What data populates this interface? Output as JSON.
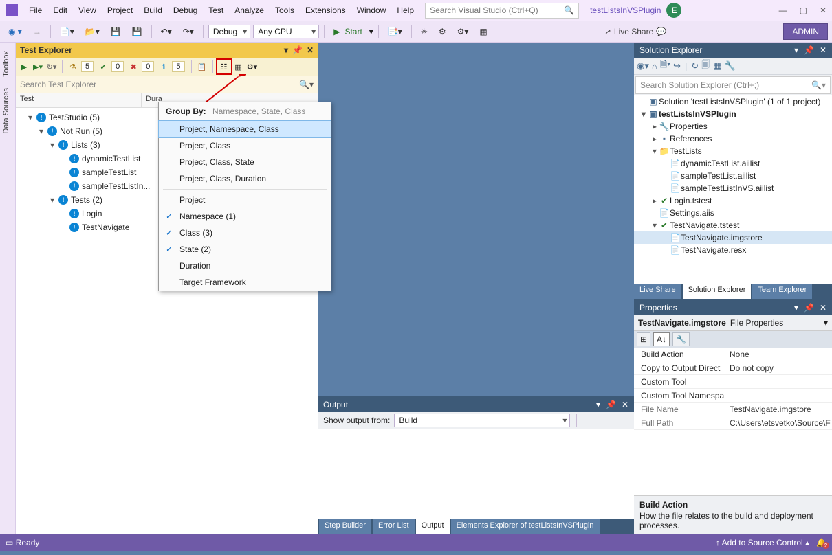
{
  "menu": [
    "File",
    "Edit",
    "View",
    "Project",
    "Build",
    "Debug",
    "Test",
    "Analyze",
    "Tools",
    "Extensions",
    "Window",
    "Help"
  ],
  "search_vs_placeholder": "Search Visual Studio (Ctrl+Q)",
  "project_name": "testListsInVSPlugin",
  "user_initial": "E",
  "toolbar": {
    "config": "Debug",
    "platform": "Any CPU",
    "start": "Start",
    "live_share": "Live Share",
    "admin": "ADMIN"
  },
  "side_tabs": [
    "Toolbox",
    "Data Sources"
  ],
  "test_explorer": {
    "title": "Test Explorer",
    "counters": {
      "flask": "5",
      "pass": "0",
      "fail": "0",
      "info": "5"
    },
    "search_placeholder": "Search Test Explorer",
    "columns": [
      "Test",
      "Dura"
    ],
    "tree": [
      {
        "level": 1,
        "open": true,
        "text": "TestStudio  (5)"
      },
      {
        "level": 2,
        "open": true,
        "text": "Not Run  (5)"
      },
      {
        "level": 3,
        "open": true,
        "text": "Lists  (3)"
      },
      {
        "level": 4,
        "text": "dynamicTestList"
      },
      {
        "level": 4,
        "text": "sampleTestList"
      },
      {
        "level": 4,
        "text": "sampleTestListIn..."
      },
      {
        "level": 3,
        "open": true,
        "text": "Tests  (2)"
      },
      {
        "level": 4,
        "text": "Login"
      },
      {
        "level": 4,
        "text": "TestNavigate"
      }
    ]
  },
  "groupby": {
    "head_label": "Group By:",
    "head_value": "Namespace, State, Class",
    "items": [
      {
        "text": "Project, Namespace, Class",
        "sel": true
      },
      {
        "text": "Project, Class"
      },
      {
        "text": "Project, Class, State"
      },
      {
        "text": "Project, Class, Duration"
      },
      {
        "sep": true
      },
      {
        "text": "Project"
      },
      {
        "text": "Namespace (1)",
        "chk": true
      },
      {
        "text": "Class (3)",
        "chk": true
      },
      {
        "text": "State (2)",
        "chk": true
      },
      {
        "text": "Duration"
      },
      {
        "text": "Target Framework"
      }
    ]
  },
  "output": {
    "title": "Output",
    "show_label": "Show output from:",
    "show_value": "Build",
    "tabs": [
      "Step Builder",
      "Error List",
      "Output",
      "Elements Explorer of testListsInVSPlugin"
    ],
    "active_tab": "Output"
  },
  "solution_explorer": {
    "title": "Solution Explorer",
    "search_placeholder": "Search Solution Explorer (Ctrl+;)",
    "tree": [
      {
        "l": 0,
        "arrow": "",
        "ico": "sln",
        "text": "Solution 'testListsInVSPlugin' (1 of 1 project)"
      },
      {
        "l": 0,
        "arrow": "▾",
        "ico": "proj",
        "bold": true,
        "text": "testListsInVSPlugin"
      },
      {
        "l": 1,
        "arrow": "▸",
        "ico": "wrench",
        "text": "Properties"
      },
      {
        "l": 1,
        "arrow": "▸",
        "ico": "ref",
        "text": "References"
      },
      {
        "l": 1,
        "arrow": "▾",
        "ico": "folder",
        "text": "TestLists"
      },
      {
        "l": 2,
        "arrow": "",
        "ico": "file",
        "text": "dynamicTestList.aiilist"
      },
      {
        "l": 2,
        "arrow": "",
        "ico": "file",
        "text": "sampleTestList.aiilist"
      },
      {
        "l": 2,
        "arrow": "",
        "ico": "file",
        "text": "sampleTestListInVS.aiilist"
      },
      {
        "l": 1,
        "arrow": "▸",
        "ico": "test",
        "text": "Login.tstest"
      },
      {
        "l": 1,
        "arrow": "",
        "ico": "file",
        "text": "Settings.aiis"
      },
      {
        "l": 1,
        "arrow": "▾",
        "ico": "test",
        "text": "TestNavigate.tstest"
      },
      {
        "l": 2,
        "arrow": "",
        "ico": "file",
        "hl": true,
        "text": "TestNavigate.imgstore"
      },
      {
        "l": 2,
        "arrow": "",
        "ico": "file",
        "text": "TestNavigate.resx"
      }
    ],
    "tabs": [
      "Live Share",
      "Solution Explorer",
      "Team Explorer"
    ],
    "active_tab": "Solution Explorer"
  },
  "properties": {
    "title": "Properties",
    "item": "TestNavigate.imgstore",
    "kind": "File Properties",
    "rows": [
      {
        "k": "Build Action",
        "v": "None"
      },
      {
        "k": "Copy to Output Direct",
        "v": "Do not copy"
      },
      {
        "k": "Custom Tool",
        "v": ""
      },
      {
        "k": "Custom Tool Namespa",
        "v": ""
      },
      {
        "k": "File Name",
        "v": "TestNavigate.imgstore",
        "mono": true
      },
      {
        "k": "Full Path",
        "v": "C:\\Users\\etsvetko\\Source\\F",
        "mono": true
      }
    ],
    "desc_title": "Build Action",
    "desc_body": "How the file relates to the build and deployment processes."
  },
  "status": {
    "ready": "Ready",
    "source_control": "Add to Source Control",
    "bell_count": "2"
  }
}
